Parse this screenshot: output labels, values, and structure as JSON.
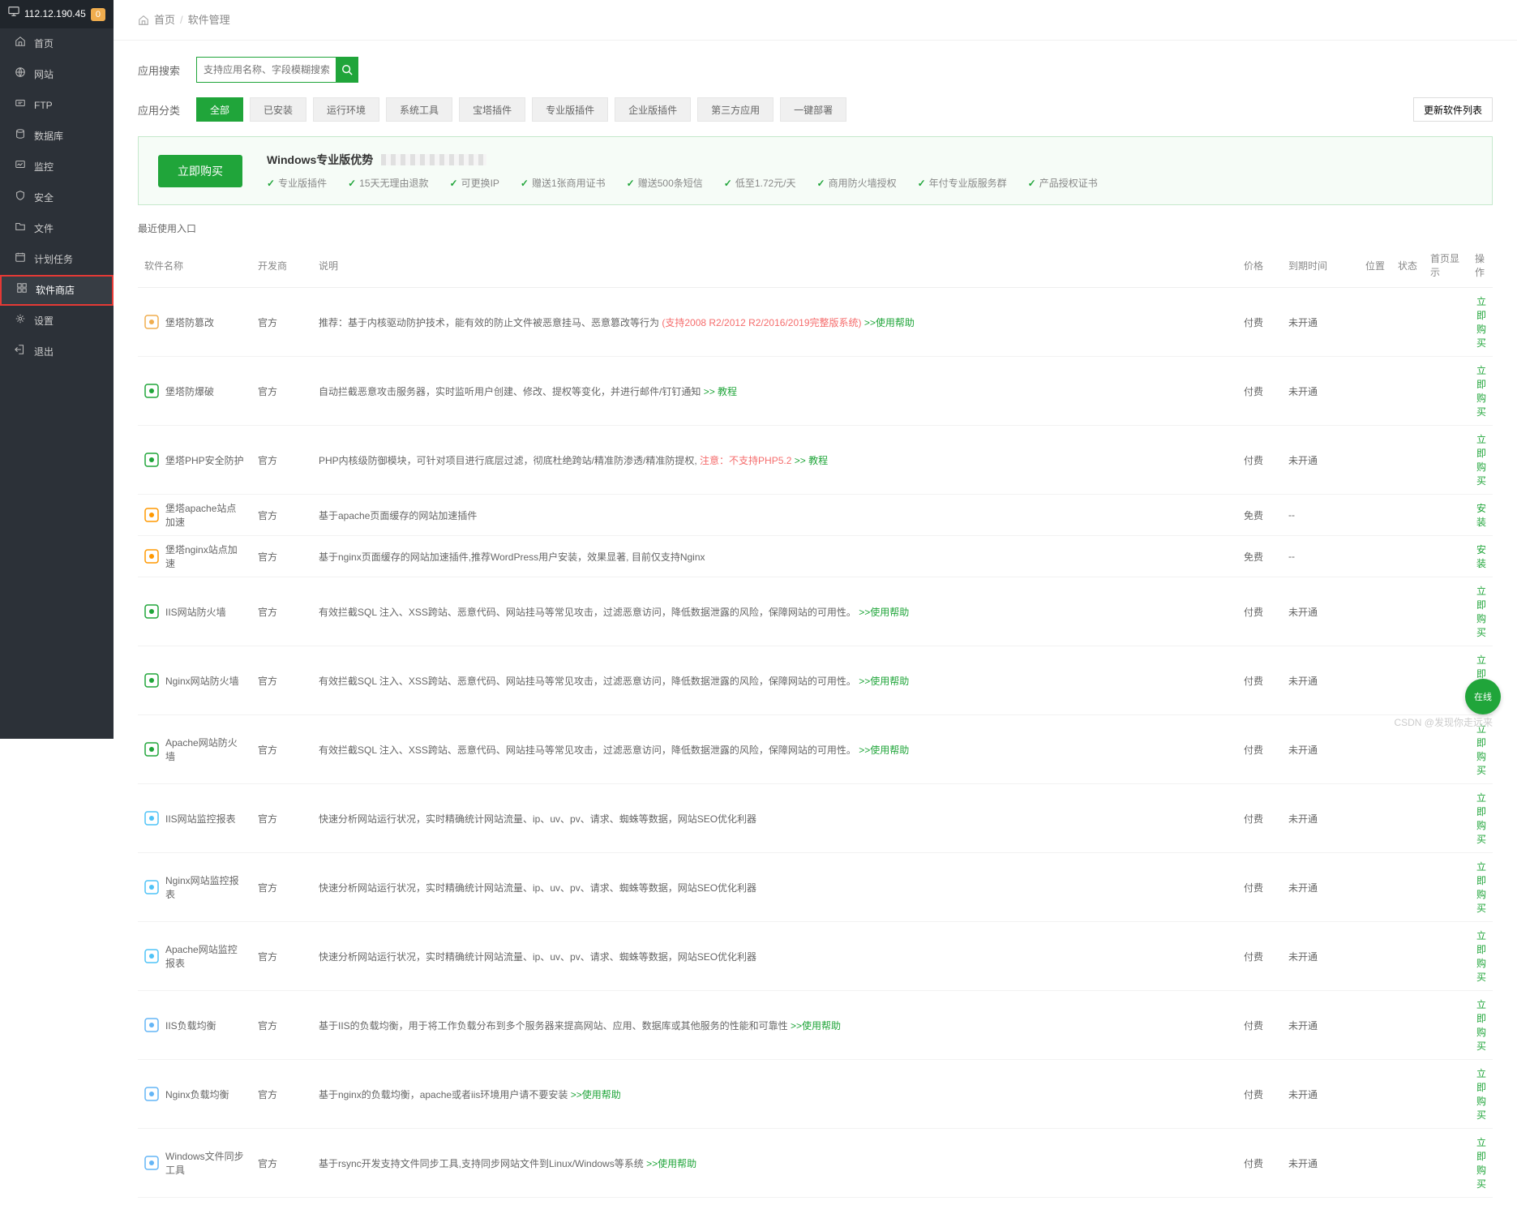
{
  "header": {
    "ip": "112.12.190.45",
    "badge": "0"
  },
  "sidebar": [
    {
      "id": "home",
      "label": "首页"
    },
    {
      "id": "site",
      "label": "网站"
    },
    {
      "id": "ftp",
      "label": "FTP"
    },
    {
      "id": "db",
      "label": "数据库"
    },
    {
      "id": "monitor",
      "label": "监控"
    },
    {
      "id": "security",
      "label": "安全"
    },
    {
      "id": "files",
      "label": "文件"
    },
    {
      "id": "cron",
      "label": "计划任务"
    },
    {
      "id": "store",
      "label": "软件商店",
      "active": true
    },
    {
      "id": "settings",
      "label": "设置"
    },
    {
      "id": "logout",
      "label": "退出"
    }
  ],
  "breadcrumb": {
    "home": "首页",
    "current": "软件管理"
  },
  "search": {
    "label": "应用搜索",
    "placeholder": "支持应用名称、字段模糊搜索"
  },
  "filter": {
    "label": "应用分类",
    "tabs": [
      "全部",
      "已安装",
      "运行环境",
      "系统工具",
      "宝塔插件",
      "专业版插件",
      "企业版插件",
      "第三方应用",
      "一键部署"
    ],
    "update": "更新软件列表"
  },
  "promo": {
    "buy": "立即购买",
    "title": "Windows专业版优势",
    "features": [
      "专业版插件",
      "15天无理由退款",
      "可更换IP",
      "赠送1张商用证书",
      "赠送500条短信",
      "低至1.72元/天",
      "商用防火墙授权",
      "年付专业版服务群",
      "产品授权证书"
    ]
  },
  "recent_label": "最近使用入口",
  "columns": {
    "name": "软件名称",
    "dev": "开发商",
    "desc": "说明",
    "price": "价格",
    "exp": "到期时间",
    "pos": "位置",
    "stat": "状态",
    "show": "首页显示",
    "act": "操作"
  },
  "rows": [
    {
      "icon": "#f0ad4e",
      "name": "堡塔防篡改",
      "dev": "官方",
      "desc": "推荐：基于内核驱动防护技术，能有效的防止文件被恶意挂马、恶意篡改等行为",
      "red": "(支持2008 R2/2012 R2/2016/2019完整版系统)",
      "help": ">>使用帮助",
      "price": "付费",
      "pt": "pay",
      "exp": "未开通",
      "act": "立即购买"
    },
    {
      "icon": "#20a53a",
      "name": "堡塔防爆破",
      "dev": "官方",
      "desc": "自动拦截恶意攻击服务器，实时监听用户创建、修改、提权等变化，并进行邮件/钉钉通知",
      "help": ">> 教程",
      "price": "付费",
      "pt": "pay",
      "exp": "未开通",
      "act": "立即购买"
    },
    {
      "icon": "#20a53a",
      "name": "堡塔PHP安全防护",
      "dev": "官方",
      "desc": "PHP内核级防御模块，可针对项目进行底层过滤，彻底杜绝跨站/精准防渗透/精准防提权,",
      "red": "注意：不支持PHP5.2",
      "help": ">> 教程",
      "price": "付费",
      "pt": "pay",
      "exp": "未开通",
      "act": "立即购买"
    },
    {
      "icon": "#ff9800",
      "name": "堡塔apache站点加速",
      "dev": "官方",
      "desc": "基于apache页面缓存的网站加速插件",
      "price": "免费",
      "pt": "free",
      "exp": "--",
      "act": "安装"
    },
    {
      "icon": "#ff9800",
      "name": "堡塔nginx站点加速",
      "dev": "官方",
      "desc": "基于nginx页面缓存的网站加速插件,推荐WordPress用户安装，效果显著, 目前仅支持Nginx",
      "price": "免费",
      "pt": "free",
      "exp": "--",
      "act": "安装"
    },
    {
      "icon": "#20a53a",
      "name": "IIS网站防火墙",
      "dev": "官方",
      "desc": "有效拦截SQL 注入、XSS跨站、恶意代码、网站挂马等常见攻击，过滤恶意访问，降低数据泄露的风险，保障网站的可用性。",
      "help": ">>使用帮助",
      "price": "付费",
      "pt": "pay",
      "exp": "未开通",
      "act": "立即购买"
    },
    {
      "icon": "#20a53a",
      "name": "Nginx网站防火墙",
      "dev": "官方",
      "desc": "有效拦截SQL 注入、XSS跨站、恶意代码、网站挂马等常见攻击，过滤恶意访问，降低数据泄露的风险，保障网站的可用性。",
      "help": ">>使用帮助",
      "price": "付费",
      "pt": "pay",
      "exp": "未开通",
      "act": "立即购买"
    },
    {
      "icon": "#20a53a",
      "name": "Apache网站防火墙",
      "dev": "官方",
      "desc": "有效拦截SQL 注入、XSS跨站、恶意代码、网站挂马等常见攻击，过滤恶意访问，降低数据泄露的风险，保障网站的可用性。",
      "help": ">>使用帮助",
      "price": "付费",
      "pt": "pay",
      "exp": "未开通",
      "act": "立即购买"
    },
    {
      "icon": "#4fc3f7",
      "name": "IIS网站监控报表",
      "dev": "官方",
      "desc": "快速分析网站运行状况，实时精确统计网站流量、ip、uv、pv、请求、蜘蛛等数据，网站SEO优化利器",
      "price": "付费",
      "pt": "pay",
      "exp": "未开通",
      "act": "立即购买"
    },
    {
      "icon": "#4fc3f7",
      "name": "Nginx网站监控报表",
      "dev": "官方",
      "desc": "快速分析网站运行状况，实时精确统计网站流量、ip、uv、pv、请求、蜘蛛等数据，网站SEO优化利器",
      "price": "付费",
      "pt": "pay",
      "exp": "未开通",
      "act": "立即购买"
    },
    {
      "icon": "#4fc3f7",
      "name": "Apache网站监控报表",
      "dev": "官方",
      "desc": "快速分析网站运行状况，实时精确统计网站流量、ip、uv、pv、请求、蜘蛛等数据，网站SEO优化利器",
      "price": "付费",
      "pt": "pay",
      "exp": "未开通",
      "act": "立即购买"
    },
    {
      "icon": "#64b5f6",
      "name": "IIS负载均衡",
      "dev": "官方",
      "desc": "基于IIS的负载均衡，用于将工作负载分布到多个服务器来提高网站、应用、数据库或其他服务的性能和可靠性",
      "help": ">>使用帮助",
      "price": "付费",
      "pt": "pay",
      "exp": "未开通",
      "act": "立即购买"
    },
    {
      "icon": "#64b5f6",
      "name": "Nginx负载均衡",
      "dev": "官方",
      "desc": "基于nginx的负载均衡，apache或者iis环境用户请不要安装",
      "help": ">>使用帮助",
      "price": "付费",
      "pt": "pay",
      "exp": "未开通",
      "act": "立即购买"
    },
    {
      "icon": "#64b5f6",
      "name": "Windows文件同步工具",
      "dev": "官方",
      "desc": "基于rsync开发支持文件同步工具,支持同步网站文件到Linux/Windows等系统",
      "help": ">>使用帮助",
      "price": "付费",
      "pt": "pay",
      "exp": "未开通",
      "act": "立即购买"
    }
  ],
  "float": "在线",
  "watermark": "CSDN @发现你走远来"
}
